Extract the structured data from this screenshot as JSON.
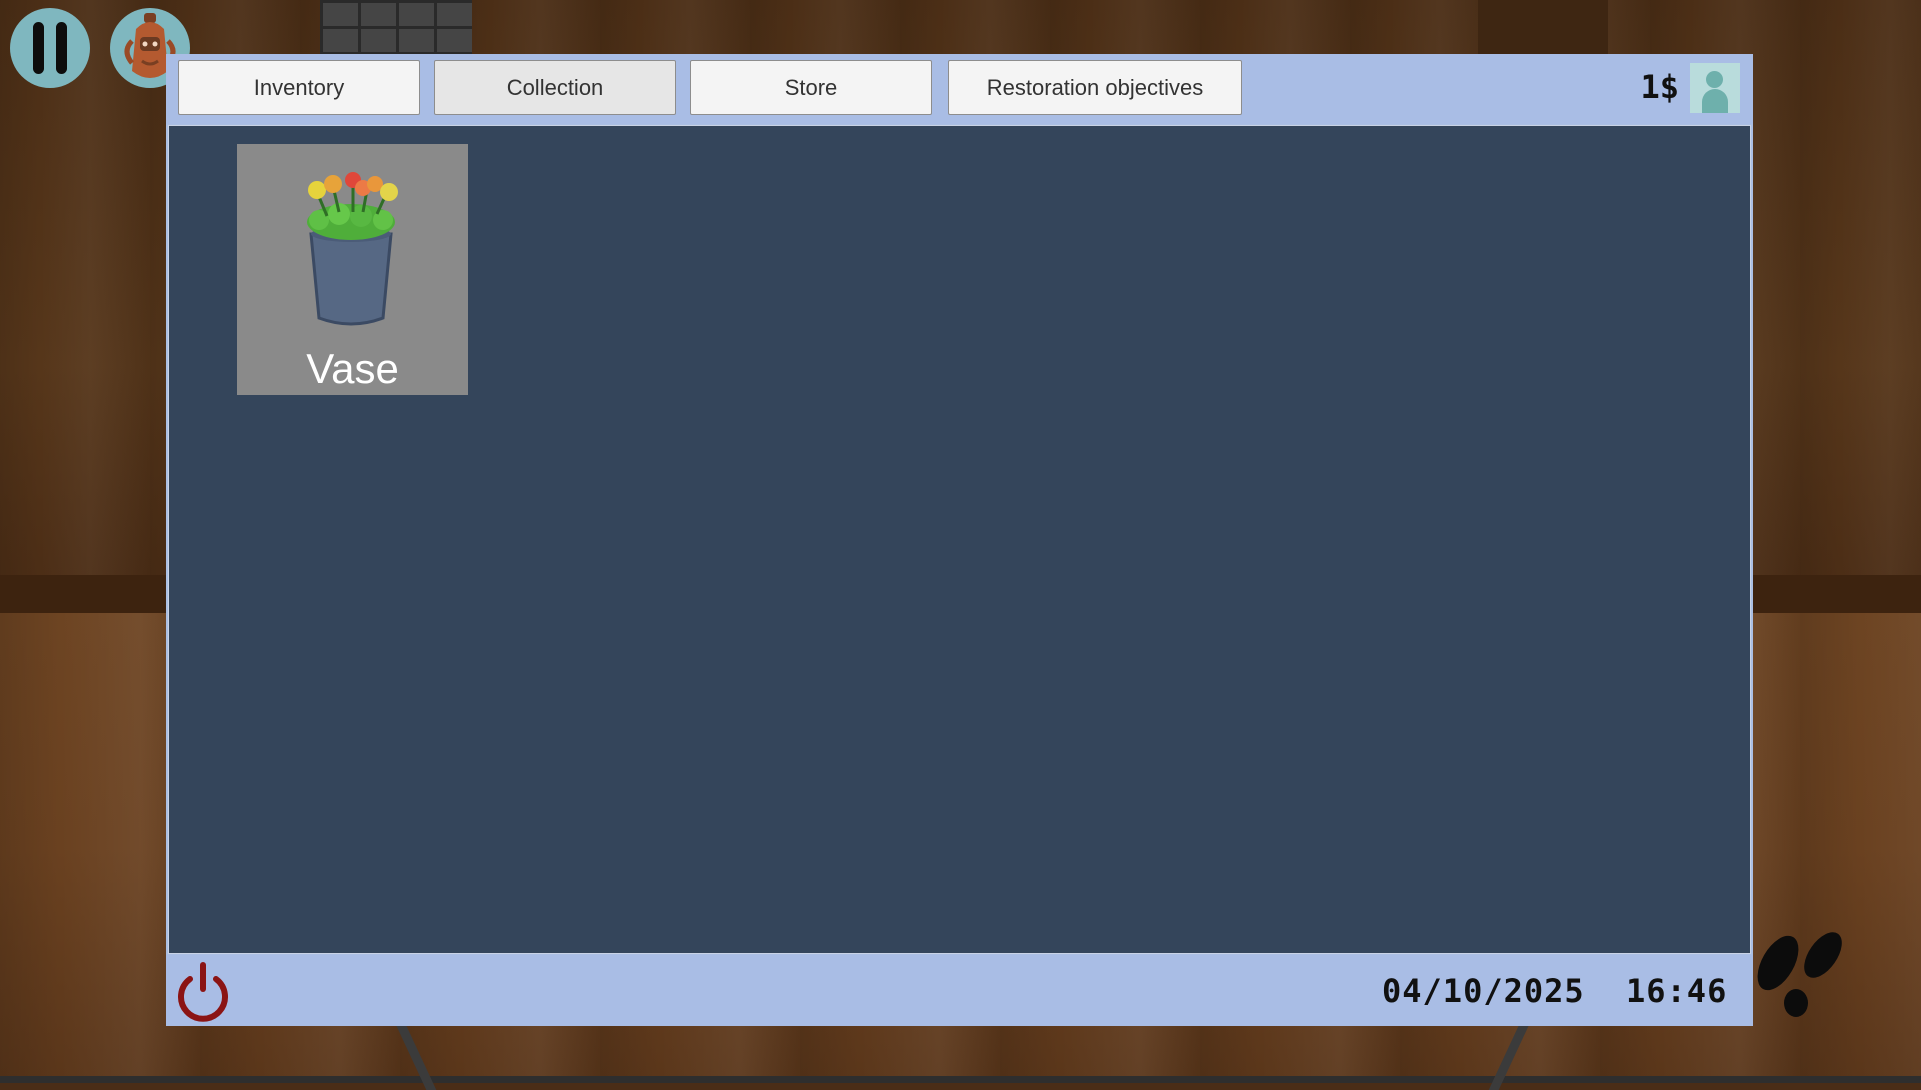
{
  "hud": {
    "pause_icon": "pause-icon",
    "character_icon": "character-icon"
  },
  "window": {
    "tabs": [
      {
        "label": "Inventory",
        "active": false
      },
      {
        "label": "Collection",
        "active": true
      },
      {
        "label": "Store",
        "active": false
      },
      {
        "label": "Restoration objectives",
        "active": false
      }
    ],
    "money": "1$",
    "profile_icon": "user-icon"
  },
  "collection": {
    "items": [
      {
        "name": "Vase",
        "icon": "flower-vase-icon"
      }
    ]
  },
  "statusbar": {
    "power_icon": "power-icon",
    "date": "04/10/2025",
    "time": "16:46"
  },
  "colors": {
    "window_bar": "#a9bde5",
    "content_bg": "#34455b",
    "hud_button": "#7fb7bf",
    "power": "#8b1414"
  }
}
